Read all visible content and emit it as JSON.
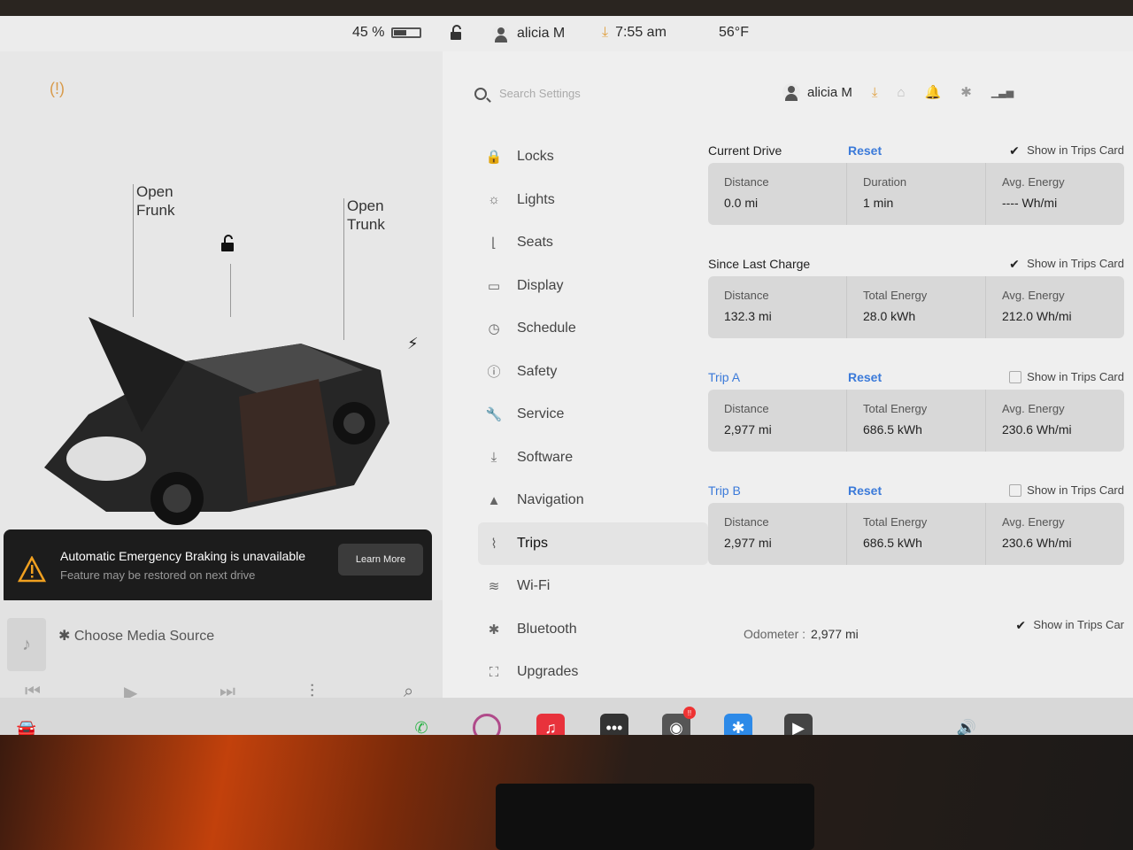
{
  "status": {
    "battery_pct": "45 %",
    "battery_level": 0.45,
    "user": "alicia M",
    "time": "7:55 am",
    "temperature": "56°F"
  },
  "car": {
    "frunk_label": "Open\nFrunk",
    "trunk_label": "Open\nTrunk"
  },
  "alert": {
    "title": "Automatic Emergency Braking is unavailable",
    "subtitle": "Feature may be restored on next drive",
    "button": "Learn More"
  },
  "media": {
    "source_label": "Choose Media Source"
  },
  "settings": {
    "search_placeholder": "Search Settings",
    "user": "alicia M",
    "nav": [
      {
        "label": "Locks",
        "icon": "lock-icon",
        "glyph": "🔒"
      },
      {
        "label": "Lights",
        "icon": "sun-icon",
        "glyph": "☼"
      },
      {
        "label": "Seats",
        "icon": "seat-icon",
        "glyph": "⌊"
      },
      {
        "label": "Display",
        "icon": "display-icon",
        "glyph": "▭"
      },
      {
        "label": "Schedule",
        "icon": "clock-icon",
        "glyph": "◷"
      },
      {
        "label": "Safety",
        "icon": "safety-icon",
        "glyph": "ⓘ"
      },
      {
        "label": "Service",
        "icon": "wrench-icon",
        "glyph": "🔧"
      },
      {
        "label": "Software",
        "icon": "download-icon",
        "glyph": "⤓"
      },
      {
        "label": "Navigation",
        "icon": "navigation-icon",
        "glyph": "▲"
      },
      {
        "label": "Trips",
        "icon": "trips-icon",
        "glyph": "⌇"
      },
      {
        "label": "Wi-Fi",
        "icon": "wifi-icon",
        "glyph": "≋"
      },
      {
        "label": "Bluetooth",
        "icon": "bluetooth-icon",
        "glyph": "✱"
      },
      {
        "label": "Upgrades",
        "icon": "bag-icon",
        "glyph": "⛶"
      }
    ],
    "trips": [
      {
        "name": "Current Drive",
        "reset": "Reset",
        "show": "Show in Trips Card",
        "checked": true,
        "cells": [
          {
            "label": "Distance",
            "value": "0.0  mi"
          },
          {
            "label": "Duration",
            "value": "1  min"
          },
          {
            "label": "Avg. Energy",
            "value": "----  Wh/mi"
          }
        ]
      },
      {
        "name": "Since Last Charge",
        "reset": "",
        "show": "Show in Trips Card",
        "checked": true,
        "cells": [
          {
            "label": "Distance",
            "value": "132.3  mi"
          },
          {
            "label": "Total Energy",
            "value": "28.0  kWh"
          },
          {
            "label": "Avg. Energy",
            "value": "212.0  Wh/mi"
          }
        ]
      },
      {
        "name": "Trip A",
        "reset": "Reset",
        "show": "Show in Trips Card",
        "checked": false,
        "cells": [
          {
            "label": "Distance",
            "value": "2,977  mi"
          },
          {
            "label": "Total Energy",
            "value": "686.5  kWh"
          },
          {
            "label": "Avg. Energy",
            "value": "230.6  Wh/mi"
          }
        ]
      },
      {
        "name": "Trip B",
        "reset": "Reset",
        "show": "Show in Trips Card",
        "checked": false,
        "cells": [
          {
            "label": "Distance",
            "value": "2,977  mi"
          },
          {
            "label": "Total Energy",
            "value": "686.5  kWh"
          },
          {
            "label": "Avg. Energy",
            "value": "230.6  Wh/mi"
          }
        ]
      }
    ],
    "odometer_label": "Odometer :",
    "odometer_value": "2,977 mi",
    "odometer_show": "Show in Trips Car"
  },
  "taskbar": {
    "camera_badge": "!!",
    "colors": {
      "phone": "#2fb34a",
      "music": "#e8323c",
      "bluetooth": "#2d8ae8",
      "dark": "#333333",
      "accent_blue": "#3b7ad9"
    }
  }
}
